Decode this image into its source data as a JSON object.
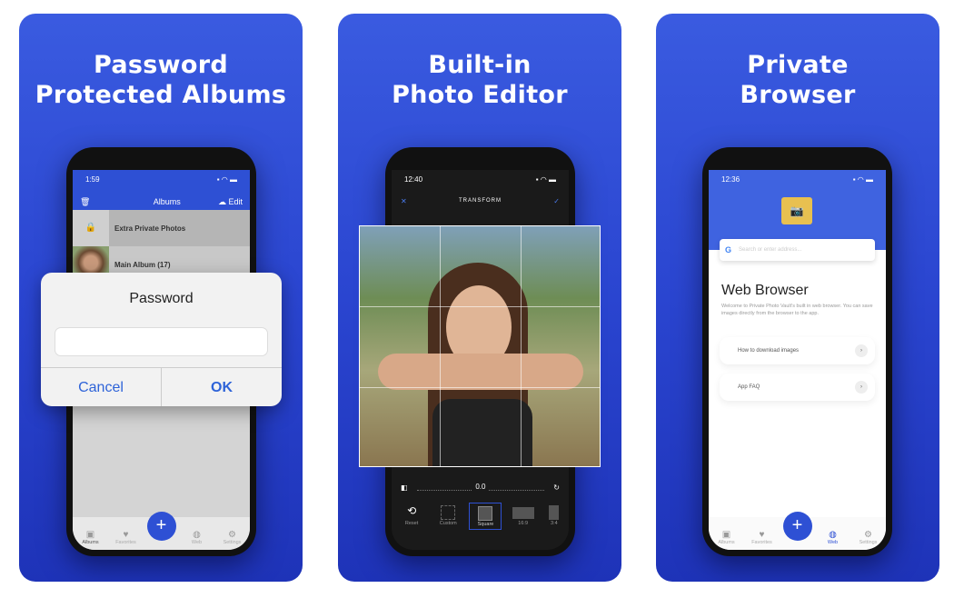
{
  "panels": [
    {
      "title_line1": "Password",
      "title_line2": "Protected Albums"
    },
    {
      "title_line1": "Built-in",
      "title_line2": "Photo Editor"
    },
    {
      "title_line1": "Private",
      "title_line2": "Browser"
    }
  ],
  "albums_screen": {
    "time": "1:59",
    "header": "Albums",
    "edit": "Edit",
    "rows": [
      "Extra Private Photos",
      "Main Album (17)"
    ]
  },
  "password_dialog": {
    "title": "Password",
    "input_value": "",
    "cancel": "Cancel",
    "ok": "OK"
  },
  "editor_screen": {
    "time": "12:40",
    "header": "TRANSFORM",
    "rotation": "0.0",
    "tools": [
      "Reset",
      "Custom",
      "Square",
      "16:9",
      "3:4"
    ],
    "selected_tool": "Square"
  },
  "browser_screen": {
    "time": "12:36",
    "search_placeholder": "Search or enter address...",
    "title": "Web Browser",
    "description": "Welcome to Private Photo Vault's built in web browser. You can save images directly from the browser to the app.",
    "links": [
      "How to download images",
      "App FAQ"
    ]
  },
  "tabbar": {
    "items": [
      "Albums",
      "Favorites",
      "Web",
      "Settings"
    ],
    "icons": [
      "albums-icon",
      "heart-icon",
      "globe-icon",
      "gear-icon"
    ]
  },
  "colors": {
    "brand": "#2e50d4",
    "panel_bg": "#2a45d0"
  }
}
